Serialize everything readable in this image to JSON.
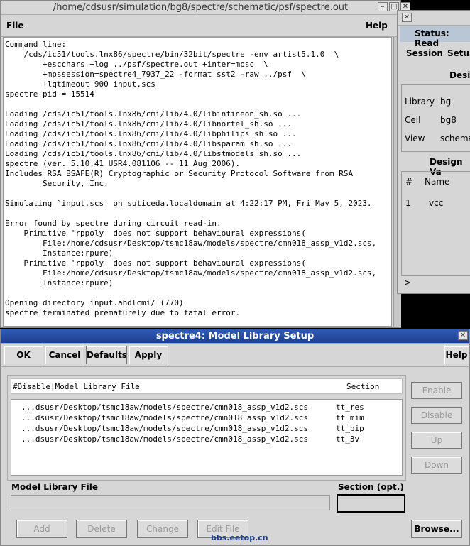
{
  "log_window": {
    "title": "/home/cdsusr/simulation/bg8/spectre/schematic/psf/spectre.out",
    "menu": {
      "file": "File",
      "help": "Help"
    },
    "controls": {
      "minimize": "–",
      "maximize": "□",
      "close": "✕"
    },
    "lines": [
      "Command line:",
      "    /cds/ic51/tools.lnx86/spectre/bin/32bit/spectre -env artist5.1.0  \\",
      "        +escchars +log ../psf/spectre.out +inter=mpsc  \\",
      "        +mpssession=spectre4_7937_22 -format sst2 -raw ../psf  \\",
      "        +lqtimeout 900 input.scs",
      "spectre pid = 15514",
      "",
      "Loading /cds/ic51/tools.lnx86/cmi/lib/4.0/libinfineon_sh.so ...",
      "Loading /cds/ic51/tools.lnx86/cmi/lib/4.0/libnortel_sh.so ...",
      "Loading /cds/ic51/tools.lnx86/cmi/lib/4.0/libphilips_sh.so ...",
      "Loading /cds/ic51/tools.lnx86/cmi/lib/4.0/libsparam_sh.so ...",
      "Loading /cds/ic51/tools.lnx86/cmi/lib/4.0/libstmodels_sh.so ...",
      "spectre (ver. 5.10.41_USR4.081106 -- 11 Aug 2006).",
      "Includes RSA BSAFE(R) Cryptographic or Security Protocol Software from RSA",
      "        Security, Inc.",
      "",
      "Simulating `input.scs' on suticeda.localdomain at 4:22:17 PM, Fri May 5, 2023.",
      "",
      "Error found by spectre during circuit read-in.",
      "    Primitive 'rppoly' does not support behavioural expressions(",
      "        File:/home/cdsusr/Desktop/tsmc18aw/models/spectre/cmn018_assp_v1d2.scs,",
      "        Instance:rpure)",
      "    Primitive 'rppoly' does not support behavioural expressions(",
      "        File:/home/cdsusr/Desktop/tsmc18aw/models/spectre/cmn018_assp_v1d2.scs,",
      "        Instance:rpure)",
      "",
      "Opening directory input.ahdlcmi/ (770)",
      "spectre terminated prematurely due to fatal error."
    ]
  },
  "status_window": {
    "title": "Status: Read",
    "menu": {
      "session": "Session",
      "setup": "Setup"
    },
    "design_heading": "Desig",
    "library_label": "Library",
    "library_value": "bg",
    "cell_label": "Cell",
    "cell_value": "bg8",
    "view_label": "View",
    "view_value": "schema",
    "design_vars_heading": "Design Va",
    "vars_headers": {
      "num": "#",
      "name": "Name"
    },
    "vars_rows": [
      {
        "num": "1",
        "name": "vcc"
      }
    ],
    "prompt": ">",
    "close": "✕"
  },
  "model_library_dialog": {
    "title": "spectre4: Model Library Setup",
    "buttons": {
      "ok": "OK",
      "cancel": "Cancel",
      "defaults": "Defaults",
      "apply": "Apply",
      "help": "Help"
    },
    "close": "✕",
    "list_header": {
      "file": "#Disable|Model Library File",
      "section": "Section"
    },
    "entries": [
      {
        "file": "...dsusr/Desktop/tsmc18aw/models/spectre/cmn018_assp_v1d2.scs",
        "section": "tt_res"
      },
      {
        "file": "...dsusr/Desktop/tsmc18aw/models/spectre/cmn018_assp_v1d2.scs",
        "section": "tt_mim"
      },
      {
        "file": "...dsusr/Desktop/tsmc18aw/models/spectre/cmn018_assp_v1d2.scs",
        "section": "tt_bip"
      },
      {
        "file": "...dsusr/Desktop/tsmc18aw/models/spectre/cmn018_assp_v1d2.scs",
        "section": "tt_3v"
      }
    ],
    "side_buttons": {
      "enable": "Enable",
      "disable": "Disable",
      "up": "Up",
      "down": "Down"
    },
    "model_library_file_label": "Model Library File",
    "model_library_file_value": "",
    "section_label": "Section (opt.)",
    "section_value": "",
    "bottom_buttons": {
      "add": "Add",
      "delete": "Delete",
      "change": "Change",
      "edit_file": "Edit File",
      "browse": "Browse..."
    }
  },
  "watermark": "bbs.eetop.cn"
}
